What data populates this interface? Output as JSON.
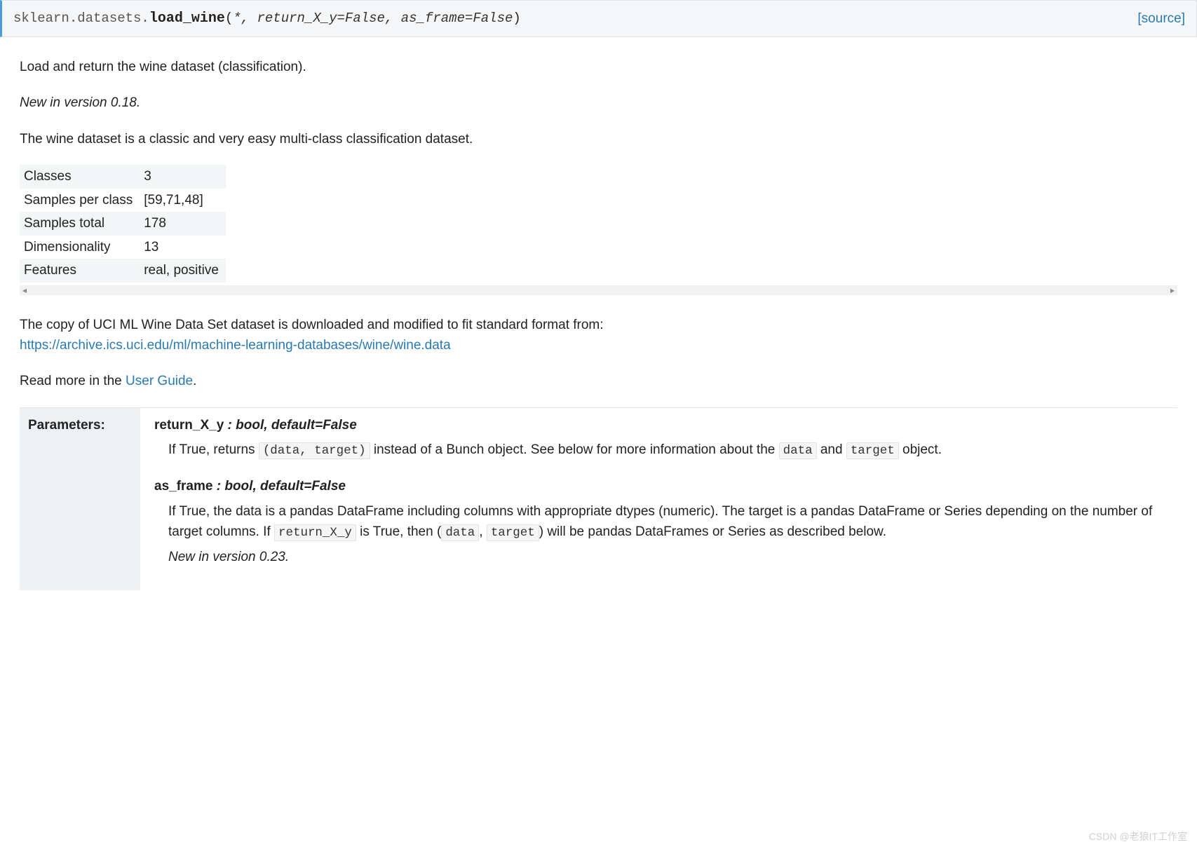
{
  "signature": {
    "module": "sklearn.datasets.",
    "func": "load_wine",
    "open": "(",
    "star": "*",
    "sep1": ", ",
    "param1": "return_X_y=False",
    "sep2": ", ",
    "param2": "as_frame=False",
    "close": ")",
    "source_label": "[source]"
  },
  "intro": {
    "p1": "Load and return the wine dataset (classification).",
    "new_in": "New in version 0.18.",
    "p2": "The wine dataset is a classic and very easy multi-class classification dataset."
  },
  "meta_table": {
    "rows": [
      {
        "k": "Classes",
        "v": "3"
      },
      {
        "k": "Samples per class",
        "v": "[59,71,48]"
      },
      {
        "k": "Samples total",
        "v": "178"
      },
      {
        "k": "Dimensionality",
        "v": "13"
      },
      {
        "k": "Features",
        "v": "real, positive"
      }
    ]
  },
  "download": {
    "pre": "The copy of UCI ML Wine Data Set dataset is downloaded and modified to fit standard format from: ",
    "url": "https://archive.ics.uci.edu/ml/machine-learning-databases/wine/wine.data",
    "read_more_pre": "Read more in the ",
    "read_more_link": "User Guide",
    "read_more_post": "."
  },
  "params": {
    "heading": "Parameters:",
    "p1": {
      "name": "return_X_y",
      "sep": " : ",
      "type": "bool, default=False",
      "desc_pre": "If True, returns ",
      "code1": "(data, target)",
      "desc_mid": " instead of a Bunch object. See below for more information about the ",
      "code2": "data",
      "desc_mid2": " and ",
      "code3": "target",
      "desc_post": " object."
    },
    "p2": {
      "name": "as_frame",
      "sep": " : ",
      "type": "bool, default=False",
      "desc_pre": "If True, the data is a pandas DataFrame including columns with appropriate dtypes (numeric). The target is a pandas DataFrame or Series depending on the number of target columns. If ",
      "code1": "return_X_y",
      "desc_mid": " is True, then (",
      "code2": "data",
      "desc_mid2": ", ",
      "code3": "target",
      "desc_post": ") will be pandas DataFrames or Series as described below.",
      "new_in": "New in version 0.23."
    }
  },
  "watermark": "CSDN @老狼IT工作室"
}
